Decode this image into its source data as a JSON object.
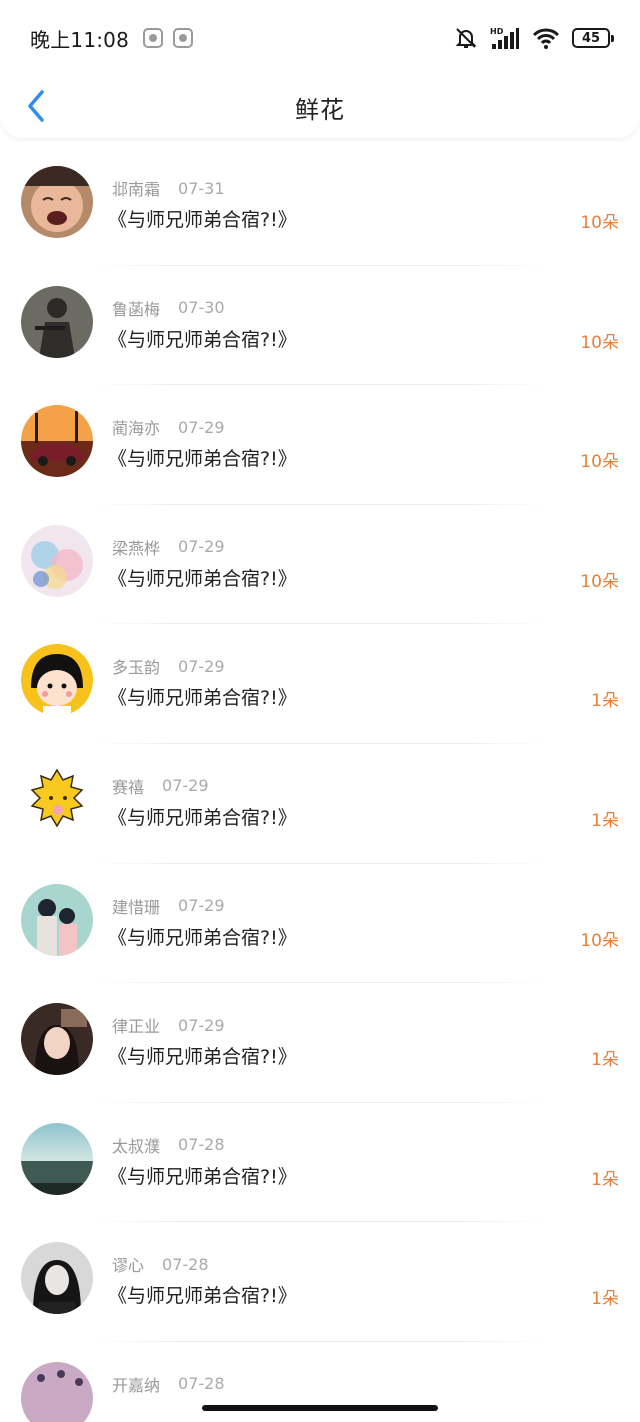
{
  "status_bar": {
    "time": "晚上11:08",
    "battery": "45",
    "icons": [
      "app-notification-icon",
      "app-notification-icon-2",
      "mute-bell-icon",
      "signal-icon",
      "wifi-icon",
      "battery-icon"
    ],
    "signal_label": "HD"
  },
  "nav": {
    "title": "鲜花",
    "back_icon": "chevron-left-icon",
    "accent_color": "#2d8ef2"
  },
  "colors": {
    "amount": "#e8803a",
    "username": "#999999",
    "title": "#222222"
  },
  "items": [
    {
      "user": "邶南霜",
      "date": "07-31",
      "title": "《与师兄师弟合宿?!》",
      "amount": "10朵",
      "avatar": "crying-baby-avatar"
    },
    {
      "user": "鲁菡梅",
      "date": "07-30",
      "title": "《与师兄师弟合宿?!》",
      "amount": "10朵",
      "avatar": "armored-soldier-avatar"
    },
    {
      "user": "蔺海亦",
      "date": "07-29",
      "title": "《与师兄师弟合宿?!》",
      "amount": "10朵",
      "avatar": "sunset-car-avatar"
    },
    {
      "user": "梁燕桦",
      "date": "07-29",
      "title": "《与师兄师弟合宿?!》",
      "amount": "10朵",
      "avatar": "watercolor-art-avatar"
    },
    {
      "user": "多玉韵",
      "date": "07-29",
      "title": "《与师兄师弟合宿?!》",
      "amount": "1朵",
      "avatar": "cartoon-girl-avatar"
    },
    {
      "user": "赛禧",
      "date": "07-29",
      "title": "《与师兄师弟合宿?!》",
      "amount": "1朵",
      "avatar": "yellow-lion-avatar"
    },
    {
      "user": "建惜珊",
      "date": "07-29",
      "title": "《与师兄师弟合宿?!》",
      "amount": "10朵",
      "avatar": "couple-illustration-avatar"
    },
    {
      "user": "律正业",
      "date": "07-29",
      "title": "《与师兄师弟合宿?!》",
      "amount": "1朵",
      "avatar": "girl-portrait-avatar"
    },
    {
      "user": "太叔濮",
      "date": "07-28",
      "title": "《与师兄师弟合宿?!》",
      "amount": "1朵",
      "avatar": "sea-landscape-avatar"
    },
    {
      "user": "谬心",
      "date": "07-28",
      "title": "《与师兄师弟合宿?!》",
      "amount": "1朵",
      "avatar": "bw-portrait-avatar"
    },
    {
      "user": "开嘉纳",
      "date": "07-28",
      "title": "",
      "amount": "",
      "avatar": "pink-pattern-avatar"
    }
  ]
}
